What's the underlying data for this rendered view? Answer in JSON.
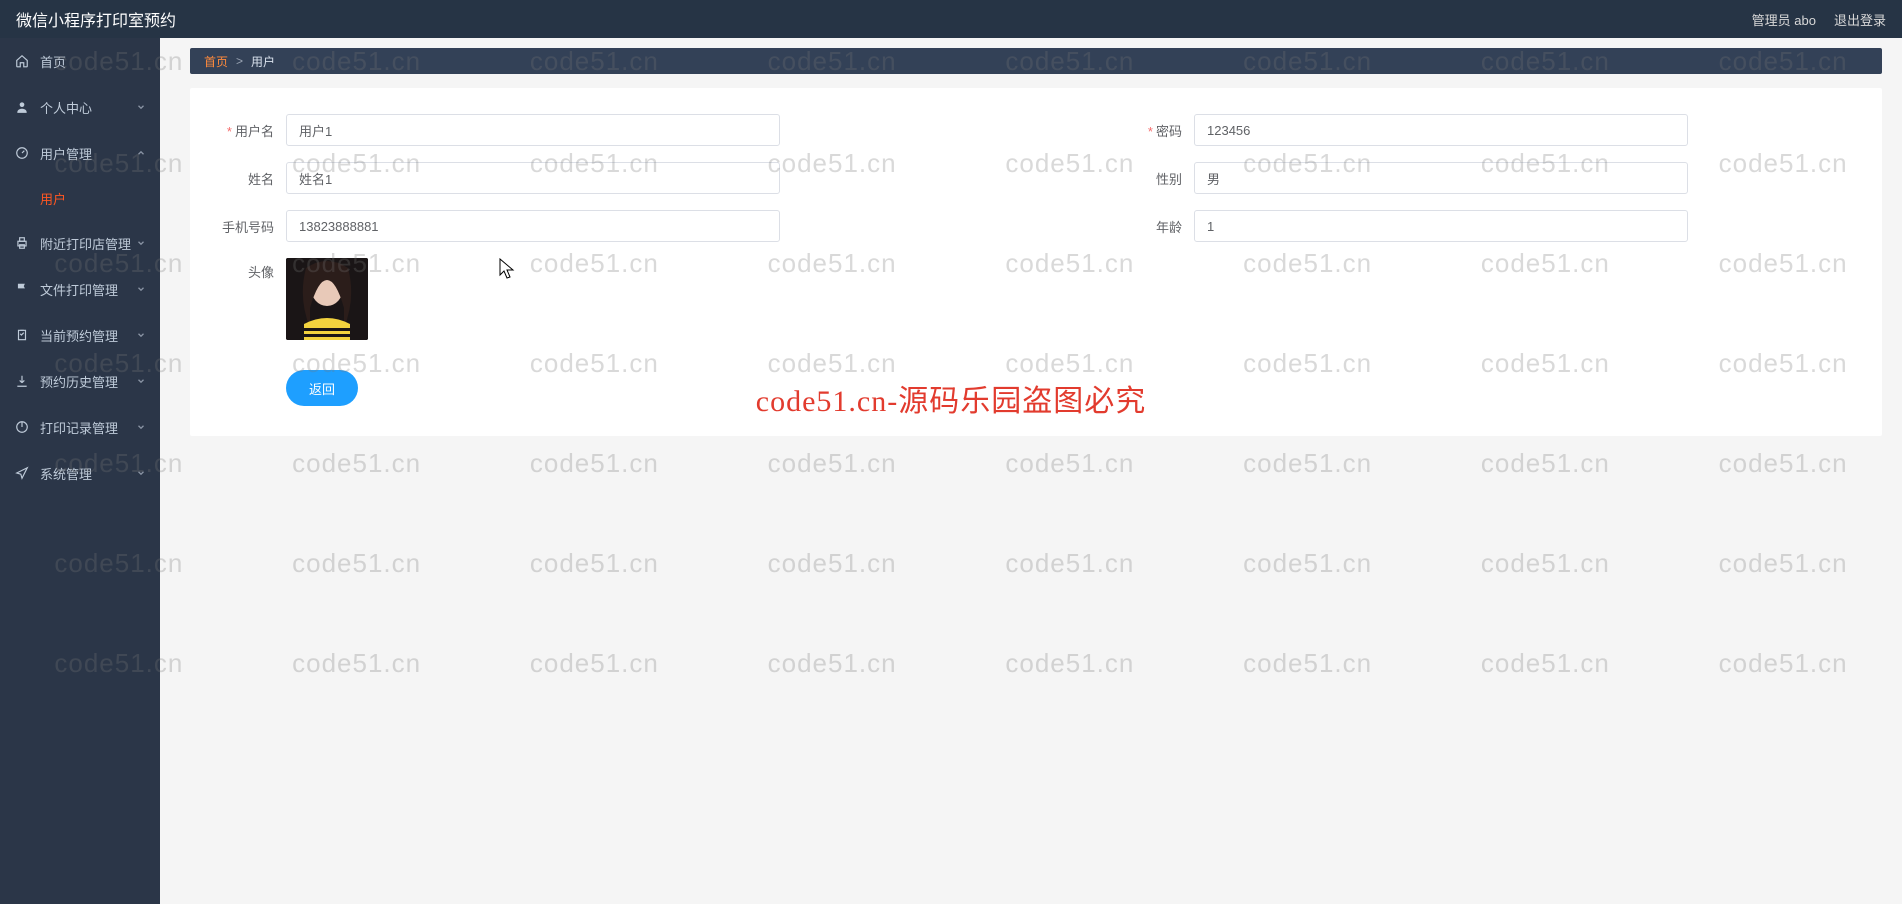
{
  "header": {
    "title": "微信小程序打印室预约",
    "admin_label": "管理员 abo",
    "logout_label": "退出登录"
  },
  "sidebar": {
    "home": "首页",
    "items": [
      {
        "label": "个人中心"
      },
      {
        "label": "用户管理",
        "expanded": true,
        "children": [
          {
            "label": "用户",
            "active": true
          }
        ]
      },
      {
        "label": "附近打印店管理"
      },
      {
        "label": "文件打印管理"
      },
      {
        "label": "当前预约管理"
      },
      {
        "label": "预约历史管理"
      },
      {
        "label": "打印记录管理"
      },
      {
        "label": "系统管理"
      }
    ]
  },
  "breadcrumb": {
    "home": "首页",
    "sep": ">",
    "current": "用户"
  },
  "form": {
    "username_label": "用户名",
    "username_value": "用户1",
    "password_label": "密码",
    "password_value": "123456",
    "name_label": "姓名",
    "name_value": "姓名1",
    "gender_label": "性别",
    "gender_value": "男",
    "phone_label": "手机号码",
    "phone_value": "13823888881",
    "age_label": "年龄",
    "age_value": "1",
    "avatar_label": "头像",
    "back_button": "返回"
  },
  "watermark": {
    "text": "code51.cn",
    "banner": "code51.cn-源码乐园盗图必究"
  }
}
